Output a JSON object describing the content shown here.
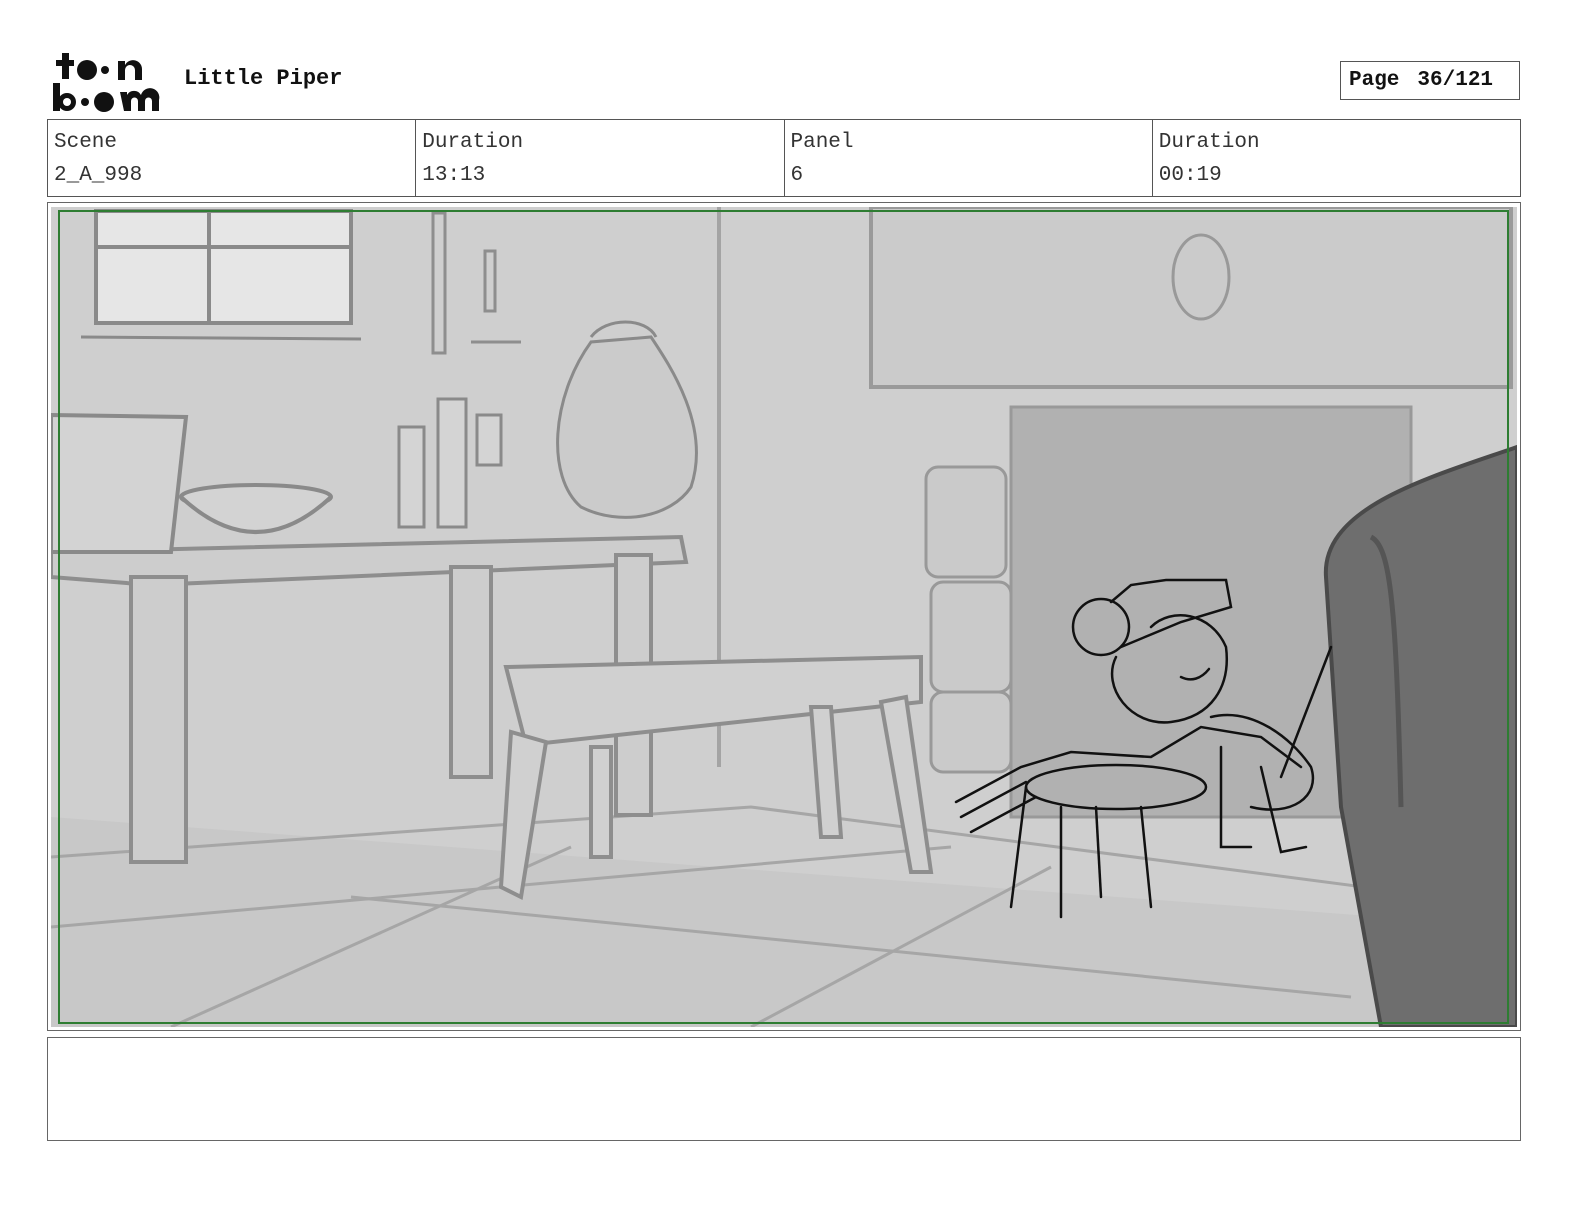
{
  "header": {
    "logo_text": "toon boom",
    "project_title": "Little Piper",
    "page_label": "Page",
    "page_value": "36/121"
  },
  "info": {
    "scene_label": "Scene",
    "scene_value": "2_A_998",
    "scene_duration_label": "Duration",
    "scene_duration_value": "13:13",
    "panel_label": "Panel",
    "panel_value": "6",
    "panel_duration_label": "Duration",
    "panel_duration_value": "00:19"
  },
  "panel": {
    "safe_frame_color": "#2e7d32",
    "background_color": "#cfcfcf"
  },
  "notes": {
    "text": ""
  }
}
